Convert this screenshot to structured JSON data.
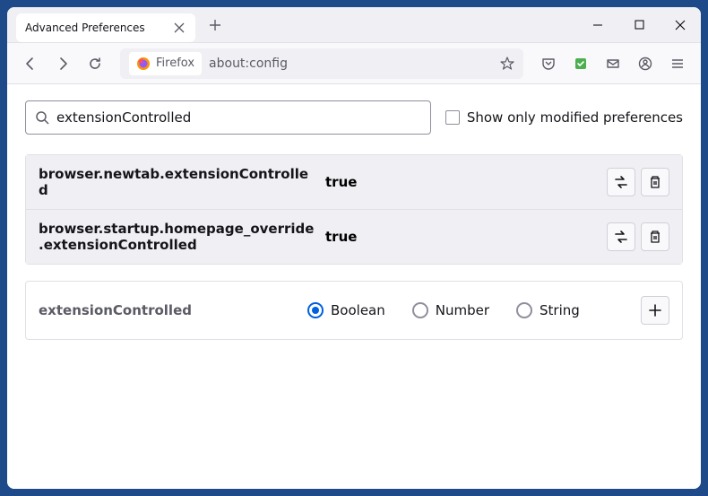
{
  "tab": {
    "title": "Advanced Preferences"
  },
  "urlbar": {
    "identity": "Firefox",
    "url": "about:config"
  },
  "search": {
    "value": "extensionControlled",
    "showModified": "Show only modified preferences"
  },
  "prefs": [
    {
      "name": "browser.newtab.extensionControlled",
      "value": "true"
    },
    {
      "name": "browser.startup.homepage_override.extensionControlled",
      "value": "true"
    }
  ],
  "newPref": {
    "name": "extensionControlled",
    "types": {
      "boolean": "Boolean",
      "number": "Number",
      "string": "String"
    }
  }
}
